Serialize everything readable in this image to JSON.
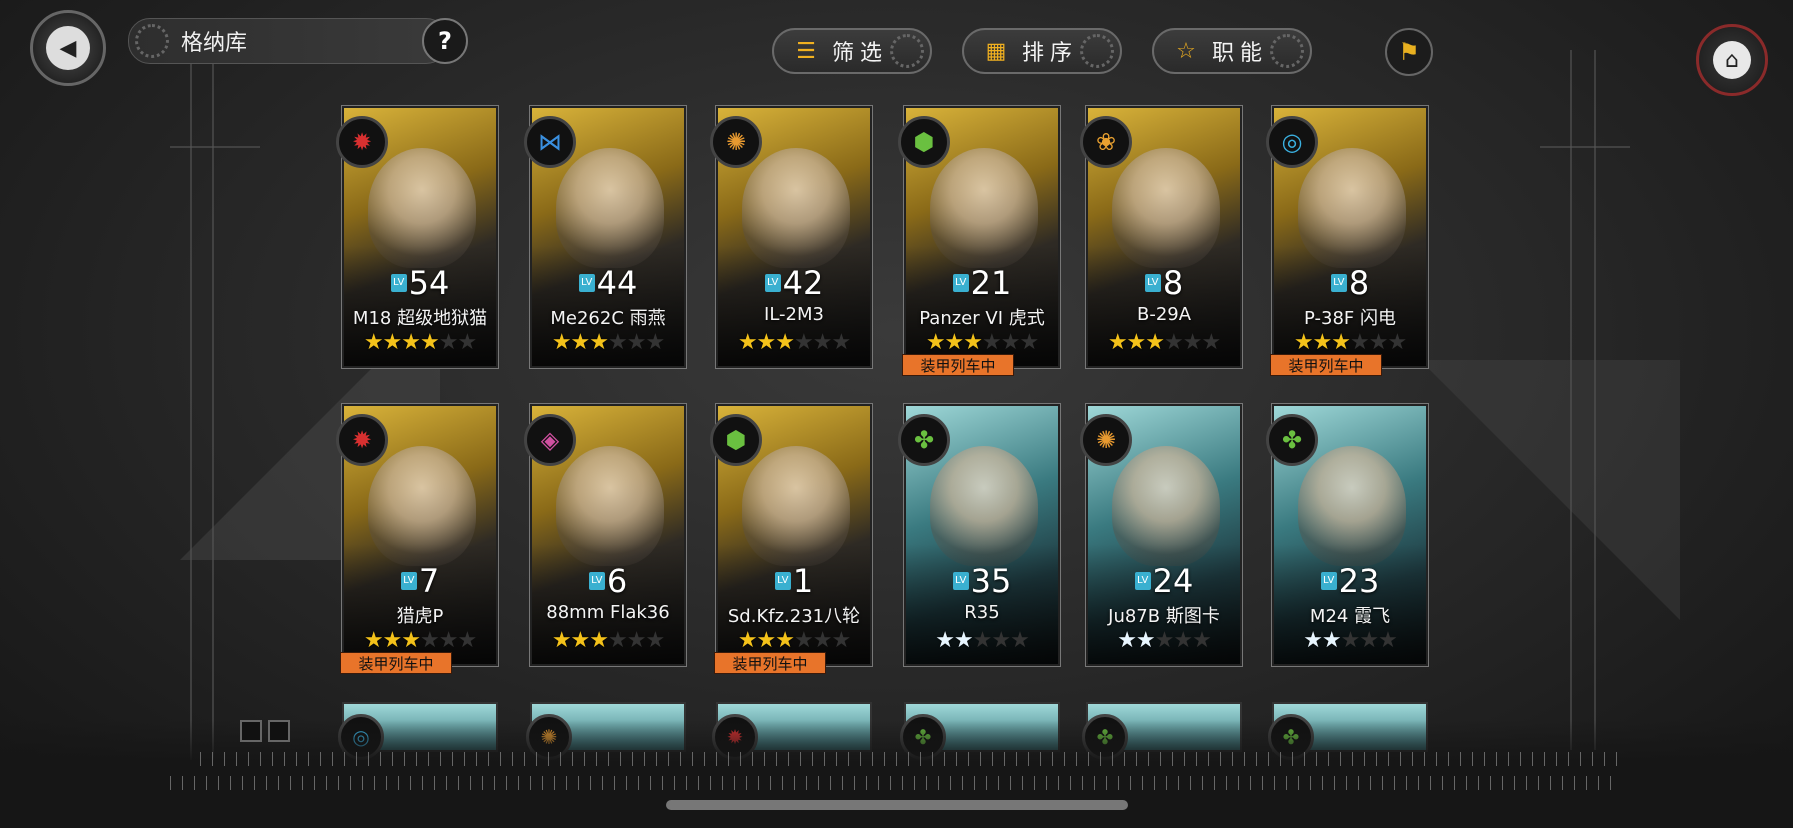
{
  "header": {
    "title": "格纳库",
    "help_glyph": "?",
    "filter_label": "筛选",
    "sort_label": "排序",
    "role_label": "职能"
  },
  "colors": {
    "accent_orange": "#e8742a",
    "gold_star": "#f4c21a",
    "level_tag": "#3ab0d0"
  },
  "cards_row1": [
    {
      "level": "54",
      "name": "M18 超级地狱猫",
      "stars": "★★★★",
      "empty": "★★",
      "frame": "gold",
      "icon": "red-gear-icon",
      "badge": ""
    },
    {
      "level": "44",
      "name": "Me262C 雨燕",
      "stars": "★★★",
      "empty": "★★★",
      "frame": "gold",
      "icon": "blue-wing-icon",
      "badge": ""
    },
    {
      "level": "42",
      "name": "IL-2M3",
      "stars": "★★★",
      "empty": "★★★",
      "frame": "gold",
      "icon": "orange-flame-icon",
      "badge": ""
    },
    {
      "level": "21",
      "name": "Panzer VI 虎式",
      "stars": "★★★",
      "empty": "★★★",
      "frame": "gold",
      "icon": "green-shield-icon",
      "badge": "装甲列车中"
    },
    {
      "level": "8",
      "name": "B-29A",
      "stars": "★★★",
      "empty": "★★★",
      "frame": "gold",
      "icon": "orange-cluster-icon",
      "badge": ""
    },
    {
      "level": "8",
      "name": "P-38F 闪电",
      "stars": "★★★",
      "empty": "★★★",
      "frame": "gold",
      "icon": "blue-ring-icon",
      "badge": "装甲列车中"
    }
  ],
  "cards_row2": [
    {
      "level": "7",
      "name": "猎虎P",
      "stars": "★★★",
      "empty": "★★★",
      "frame": "gold",
      "icon": "red-gear-icon",
      "badge": "装甲列车中"
    },
    {
      "level": "6",
      "name": "88mm Flak36",
      "stars": "★★★",
      "empty": "★★★",
      "frame": "gold",
      "icon": "pink-diamond-icon",
      "badge": ""
    },
    {
      "level": "1",
      "name": "Sd.Kfz.231八轮",
      "stars": "★★★",
      "empty": "★★★",
      "frame": "gold",
      "icon": "green-shield-icon",
      "badge": "装甲列车中"
    },
    {
      "level": "35",
      "name": "R35",
      "stars": "★★",
      "empty": "★★★",
      "frame": "teal",
      "icon": "green-tree-icon",
      "badge": ""
    },
    {
      "level": "24",
      "name": "Ju87B 斯图卡",
      "stars": "★★",
      "empty": "★★★",
      "frame": "teal",
      "icon": "orange-flame-icon",
      "badge": ""
    },
    {
      "level": "23",
      "name": "M24 霞飞",
      "stars": "★★",
      "empty": "★★★",
      "frame": "teal",
      "icon": "green-tree-icon",
      "badge": ""
    }
  ],
  "level_tag_text": "LV"
}
